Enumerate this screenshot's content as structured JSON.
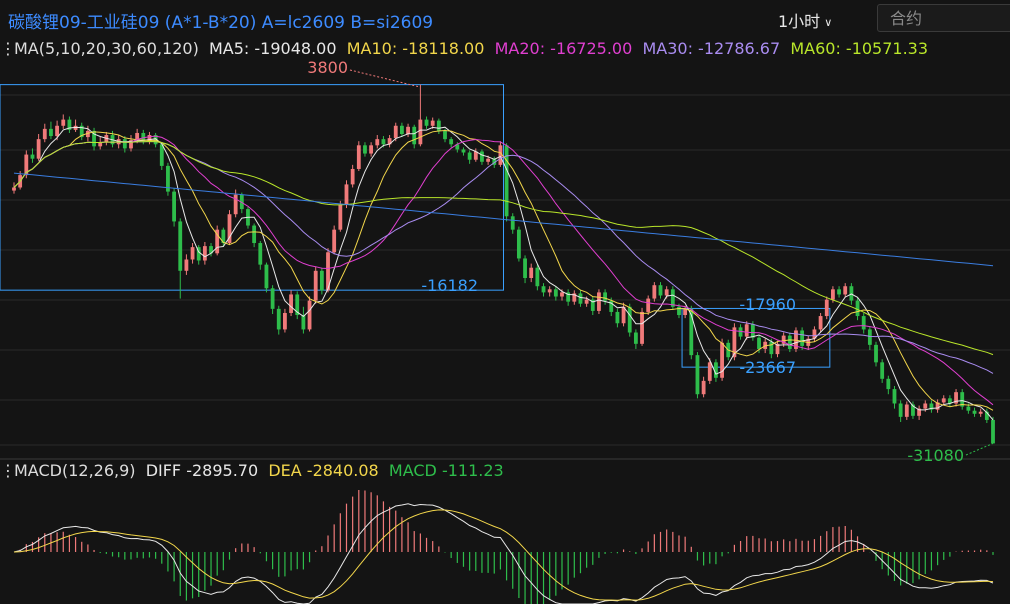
{
  "header": {
    "title": "碳酸锂09-工业硅09 (A*1-B*20) A=lc2609 B=si2609",
    "period": "1小时",
    "search_placeholder": "合约"
  },
  "ma_legend": {
    "label": "MA(5,10,20,30,60,120)",
    "items": [
      {
        "label": "MA5: -19048.00",
        "color": "#e8e8e8"
      },
      {
        "label": "MA10: -18118.00",
        "color": "#f2d64b"
      },
      {
        "label": "MA20: -16725.00",
        "color": "#e03fd0"
      },
      {
        "label": "MA30: -12786.67",
        "color": "#a98cf0"
      },
      {
        "label": "MA60: -10571.33",
        "color": "#b9e62a"
      }
    ]
  },
  "macd_legend": {
    "label": "MACD(12,26,9)",
    "diff": {
      "label": "DIFF -2895.70",
      "color": "#e8e8e8"
    },
    "dea": {
      "label": "DEA -2840.08",
      "color": "#f2d64b"
    },
    "macd": {
      "label": "MACD -111.23",
      "color": "#2ebd4b"
    }
  },
  "colors": {
    "up": "#f07a7a",
    "down": "#2ebd4b",
    "box": "#3aa0ff",
    "grid": "#2a2a2a",
    "ma120": "#3a7de0"
  },
  "chart_data": [
    {
      "type": "candlestick",
      "title": "碳酸锂09-工业硅09 (A*1-B*20) A=lc2609 B=si2609",
      "period": "1小时",
      "ylim": [
        -32500,
        6000
      ],
      "annotations": [
        {
          "label": "3800",
          "value": 3800,
          "kind": "high",
          "color": "#f07a7a"
        },
        {
          "label": "-16182",
          "value": -16182,
          "kind": "box-low",
          "color": "#3aa0ff"
        },
        {
          "label": "-17960",
          "value": -17960,
          "kind": "box-high",
          "color": "#3aa0ff"
        },
        {
          "label": "-23667",
          "value": -23667,
          "kind": "box-low",
          "color": "#3aa0ff"
        },
        {
          "label": "-31080",
          "value": -31080,
          "kind": "low",
          "color": "#2ebd4b"
        }
      ],
      "boxes": [
        {
          "from_bar": 0,
          "to_bar": 79,
          "high": 3800,
          "low": -16182
        },
        {
          "from_bar": 109,
          "to_bar": 132,
          "high": -17960,
          "low": -23667
        }
      ],
      "series": [
        {
          "name": "MA5",
          "last": -19048.0,
          "color": "#e8e8e8"
        },
        {
          "name": "MA10",
          "last": -18118.0,
          "color": "#f2d64b"
        },
        {
          "name": "MA20",
          "last": -16725.0,
          "color": "#e03fd0"
        },
        {
          "name": "MA30",
          "last": -12786.67,
          "color": "#a98cf0"
        },
        {
          "name": "MA60",
          "last": -10571.33,
          "color": "#b9e62a"
        }
      ],
      "candles": [
        [
          -6500,
          -6200,
          -5700,
          -6800
        ],
        [
          -6200,
          -5000,
          -4600,
          -6400
        ],
        [
          -5000,
          -3000,
          -2600,
          -5300
        ],
        [
          -3000,
          -3400,
          -2400,
          -3800
        ],
        [
          -3400,
          -1500,
          -1000,
          -3600
        ],
        [
          -1500,
          -500,
          0,
          -1800
        ],
        [
          -500,
          -1200,
          200,
          -1500
        ],
        [
          -1200,
          -200,
          300,
          -1600
        ],
        [
          -200,
          400,
          900,
          -500
        ],
        [
          400,
          -600,
          700,
          -900
        ],
        [
          -600,
          -200,
          400,
          -800
        ],
        [
          -200,
          -1300,
          100,
          -1600
        ],
        [
          -1300,
          -700,
          -200,
          -1700
        ],
        [
          -700,
          -2200,
          -400,
          -2600
        ],
        [
          -2200,
          -1800,
          -1300,
          -2500
        ],
        [
          -1800,
          -1100,
          -800,
          -2100
        ],
        [
          -1100,
          -2000,
          -700,
          -2300
        ],
        [
          -2000,
          -1500,
          -1100,
          -2400
        ],
        [
          -1500,
          -2400,
          -1200,
          -2800
        ],
        [
          -2400,
          -1600,
          -1100,
          -2700
        ],
        [
          -1600,
          -900,
          -500,
          -1900
        ],
        [
          -900,
          -1700,
          -600,
          -2000
        ],
        [
          -1700,
          -1100,
          -800,
          -2000
        ],
        [
          -1100,
          -2000,
          -900,
          -2300
        ],
        [
          -2000,
          -4100,
          -1800,
          -4500
        ],
        [
          -4100,
          -6600,
          -3800,
          -7000
        ],
        [
          -6600,
          -9500,
          -6300,
          -10000
        ],
        [
          -9500,
          -14300,
          -9200,
          -17000
        ],
        [
          -14300,
          -13200,
          -12700,
          -14700
        ],
        [
          -13200,
          -12000,
          -11600,
          -13600
        ],
        [
          -12000,
          -13300,
          -11800,
          -13700
        ],
        [
          -13300,
          -11900,
          -11500,
          -13700
        ],
        [
          -11900,
          -12600,
          -11600,
          -12900
        ],
        [
          -12600,
          -10300,
          -9900,
          -12800
        ],
        [
          -10300,
          -11600,
          -10100,
          -11900
        ],
        [
          -11600,
          -8800,
          -8400,
          -11800
        ],
        [
          -8800,
          -6900,
          -6400,
          -9100
        ],
        [
          -6900,
          -8300,
          -6700,
          -8700
        ],
        [
          -8300,
          -9900,
          -8100,
          -10200
        ],
        [
          -9900,
          -11600,
          -9700,
          -12000
        ],
        [
          -11600,
          -13700,
          -11400,
          -14200
        ],
        [
          -13700,
          -16000,
          -13500,
          -16400
        ],
        [
          -16000,
          -18000,
          -15700,
          -18500
        ],
        [
          -18000,
          -20000,
          -17700,
          -20500
        ],
        [
          -20000,
          -18400,
          -18000,
          -20300
        ],
        [
          -18400,
          -16600,
          -16200,
          -18700
        ],
        [
          -16600,
          -18600,
          -16300,
          -19000
        ],
        [
          -18600,
          -20000,
          -17800,
          -20400
        ],
        [
          -20000,
          -17200,
          -16800,
          -20200
        ],
        [
          -17200,
          -14300,
          -13900,
          -17500
        ],
        [
          -14300,
          -16200,
          -14000,
          -16600
        ],
        [
          -16200,
          -12500,
          -12100,
          -16400
        ],
        [
          -12500,
          -10300,
          -9900,
          -12700
        ],
        [
          -10300,
          -7900,
          -7500,
          -10500
        ],
        [
          -7900,
          -5900,
          -5500,
          -8200
        ],
        [
          -5900,
          -4400,
          -4000,
          -6200
        ],
        [
          -4400,
          -2100,
          -1700,
          -4600
        ],
        [
          -2100,
          -2900,
          -1800,
          -3200
        ],
        [
          -2900,
          -2100,
          -1800,
          -3200
        ],
        [
          -2100,
          -1500,
          -1100,
          -2400
        ],
        [
          -1500,
          -2000,
          -1200,
          -2300
        ],
        [
          -2000,
          -1400,
          -1100,
          -2300
        ],
        [
          -1400,
          -200,
          100,
          -1700
        ],
        [
          -200,
          -1000,
          100,
          -1300
        ],
        [
          -1000,
          -300,
          0,
          -1300
        ],
        [
          -300,
          -2000,
          -100,
          -2400
        ],
        [
          -2000,
          400,
          3800,
          -2200
        ],
        [
          400,
          -200,
          700,
          -500
        ],
        [
          -200,
          300,
          600,
          -500
        ],
        [
          300,
          -700,
          500,
          -1000
        ],
        [
          -700,
          -1500,
          -500,
          -1800
        ],
        [
          -1500,
          -2000,
          -1300,
          -2300
        ],
        [
          -2000,
          -2500,
          -1800,
          -2800
        ],
        [
          -2500,
          -2800,
          -2300,
          -3100
        ],
        [
          -2800,
          -3500,
          -2600,
          -3900
        ],
        [
          -3500,
          -2700,
          -2400,
          -3700
        ],
        [
          -2700,
          -3700,
          -2500,
          -4000
        ],
        [
          -3700,
          -3400,
          -3100,
          -4000
        ],
        [
          -3400,
          -4000,
          -3200,
          -4300
        ],
        [
          -4000,
          -2100,
          -1700,
          -4200
        ],
        [
          -2100,
          -9000,
          -1900,
          -9500
        ],
        [
          -9000,
          -10300,
          -8700,
          -10700
        ],
        [
          -10300,
          -13100,
          -10000,
          -13400
        ],
        [
          -13100,
          -15000,
          -12800,
          -15500
        ],
        [
          -15000,
          -14000,
          -13600,
          -15400
        ],
        [
          -14000,
          -15800,
          -13700,
          -16200
        ],
        [
          -15800,
          -16400,
          -15500,
          -16800
        ],
        [
          -16400,
          -16100,
          -15800,
          -16800
        ],
        [
          -16100,
          -16800,
          -15800,
          -17200
        ],
        [
          -16800,
          -16400,
          -16100,
          -17200
        ],
        [
          -16400,
          -17300,
          -16100,
          -17700
        ],
        [
          -17300,
          -16500,
          -16200,
          -17600
        ],
        [
          -16500,
          -17500,
          -16200,
          -17800
        ],
        [
          -17500,
          -17100,
          -16800,
          -17800
        ],
        [
          -17100,
          -18200,
          -16800,
          -18600
        ],
        [
          -18200,
          -16400,
          -16100,
          -18500
        ],
        [
          -16400,
          -17200,
          -16100,
          -17600
        ],
        [
          -17200,
          -18300,
          -16900,
          -18700
        ],
        [
          -18300,
          -19400,
          -18000,
          -19800
        ],
        [
          -19400,
          -17800,
          -17400,
          -19700
        ],
        [
          -17800,
          -20300,
          -17500,
          -20700
        ],
        [
          -20300,
          -21400,
          -20000,
          -21900
        ],
        [
          -21400,
          -18300,
          -17900,
          -21600
        ],
        [
          -18300,
          -17000,
          -16700,
          -18600
        ],
        [
          -17000,
          -15700,
          -15400,
          -17300
        ],
        [
          -15700,
          -16700,
          -15400,
          -17000
        ],
        [
          -16700,
          -16100,
          -15800,
          -17000
        ],
        [
          -16100,
          -17800,
          -15800,
          -18100
        ],
        [
          -17800,
          -18600,
          -17500,
          -18900
        ],
        [
          -18600,
          -18000,
          -17700,
          -18900
        ],
        [
          -18000,
          -22500,
          -17700,
          -22900
        ],
        [
          -22500,
          -26300,
          -22200,
          -26700
        ],
        [
          -26300,
          -25000,
          -24600,
          -26600
        ],
        [
          -25000,
          -23200,
          -22800,
          -25300
        ],
        [
          -23200,
          -24700,
          -22900,
          -25100
        ],
        [
          -24700,
          -21300,
          -20900,
          -25000
        ],
        [
          -21300,
          -22700,
          -21000,
          -23000
        ],
        [
          -22700,
          -19800,
          -19400,
          -23000
        ],
        [
          -19800,
          -20700,
          -19500,
          -21000
        ],
        [
          -20700,
          -19500,
          -19200,
          -21000
        ],
        [
          -19500,
          -20800,
          -19200,
          -21100
        ],
        [
          -20800,
          -21900,
          -20500,
          -22300
        ],
        [
          -21900,
          -21200,
          -20900,
          -22300
        ],
        [
          -21200,
          -22400,
          -20900,
          -22800
        ],
        [
          -22400,
          -21400,
          -21100,
          -22700
        ],
        [
          -21400,
          -20600,
          -20300,
          -21700
        ],
        [
          -20600,
          -21900,
          -20300,
          -22200
        ],
        [
          -21900,
          -20100,
          -19800,
          -22200
        ],
        [
          -20100,
          -21600,
          -19800,
          -22000
        ],
        [
          -21600,
          -20900,
          -20600,
          -22000
        ],
        [
          -20900,
          -20000,
          -19700,
          -21200
        ],
        [
          -20000,
          -18700,
          -18400,
          -20300
        ],
        [
          -18700,
          -17100,
          -16800,
          -19000
        ],
        [
          -17100,
          -16100,
          -15800,
          -17400
        ],
        [
          -16100,
          -16600,
          -15800,
          -16900
        ],
        [
          -16600,
          -15800,
          -15500,
          -16900
        ],
        [
          -15800,
          -17200,
          -15500,
          -17600
        ],
        [
          -17200,
          -18700,
          -16900,
          -19100
        ],
        [
          -18700,
          -20000,
          -18400,
          -20400
        ],
        [
          -20000,
          -21500,
          -19700,
          -22000
        ],
        [
          -21500,
          -23200,
          -21200,
          -23600
        ],
        [
          -23200,
          -24800,
          -22900,
          -25200
        ],
        [
          -24800,
          -25800,
          -24500,
          -26300
        ],
        [
          -25800,
          -27200,
          -25500,
          -27700
        ],
        [
          -27200,
          -28500,
          -26900,
          -29000
        ],
        [
          -28500,
          -27300,
          -27000,
          -28800
        ],
        [
          -27300,
          -28400,
          -27000,
          -28700
        ],
        [
          -28400,
          -27700,
          -27400,
          -28800
        ],
        [
          -27700,
          -27200,
          -26900,
          -28000
        ],
        [
          -27200,
          -27800,
          -26900,
          -28100
        ],
        [
          -27800,
          -27100,
          -26800,
          -28100
        ],
        [
          -27100,
          -26700,
          -26400,
          -27400
        ],
        [
          -26700,
          -27200,
          -26400,
          -27500
        ],
        [
          -27200,
          -26100,
          -25800,
          -27500
        ],
        [
          -26100,
          -27500,
          -25800,
          -27800
        ],
        [
          -27500,
          -27900,
          -27200,
          -28200
        ],
        [
          -27900,
          -28200,
          -27600,
          -28500
        ],
        [
          -28200,
          -28000,
          -27700,
          -28500
        ],
        [
          -28000,
          -28800,
          -27700,
          -29100
        ],
        [
          -28800,
          -31080,
          -28500,
          -31080
        ]
      ],
      "ma_values": {
        "MA120": {
          "from": -4800,
          "to": -13800
        }
      }
    },
    {
      "type": "bar+line",
      "title": "MACD(12,26,9)",
      "series": [
        {
          "name": "DIFF",
          "last": -2895.7,
          "color": "#e8e8e8"
        },
        {
          "name": "DEA",
          "last": -2840.08,
          "color": "#f2d64b"
        },
        {
          "name": "MACD",
          "last": -111.23,
          "color": "#2ebd4b"
        }
      ]
    }
  ]
}
